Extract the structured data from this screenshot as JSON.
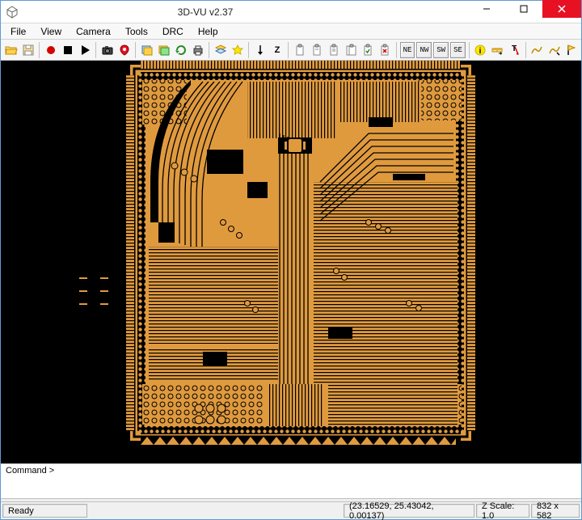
{
  "window": {
    "title": "3D-VU v2.37"
  },
  "menu": {
    "file": "File",
    "view": "View",
    "camera": "Camera",
    "tools": "Tools",
    "drc": "DRC",
    "help": "Help"
  },
  "toolbar": {
    "open": "open-file-icon",
    "save": "save-icon",
    "record": "record-icon",
    "stop": "stop-icon",
    "play": "play-icon",
    "snapshot": "camera-icon",
    "pin": "locate-icon",
    "layers1": "layers-icon",
    "layers2": "layers-icon",
    "refresh": "refresh-icon",
    "print": "print-icon",
    "layers_menu": "layer-stack-icon",
    "highlight": "highlight-icon",
    "z_down": "z-arrow-icon",
    "z_label": "Z",
    "clipboard1": "clipboard-icon",
    "clipboard2": "clipboard-icon",
    "clipboard3": "clipboard-icon",
    "clipboard4": "clipboard-icon",
    "clipboard5": "clipboard-icon",
    "clipboard6": "clipboard-icon",
    "ne_label": "NE",
    "nw_label": "NW",
    "sw_label": "SW",
    "se_label": "SE",
    "info": "info-icon",
    "ruler": "ruler-icon",
    "text_mark": "text-marker-icon",
    "wave1": "measure-icon",
    "wave2": "measure-icon",
    "flag": "flag-icon"
  },
  "command": {
    "prompt": "Command >"
  },
  "status": {
    "ready": "Ready",
    "coords": "(23.16529, 25.43042, 0.00137)",
    "zscale": "Z Scale: 1.0",
    "dims": "832 x 582"
  }
}
